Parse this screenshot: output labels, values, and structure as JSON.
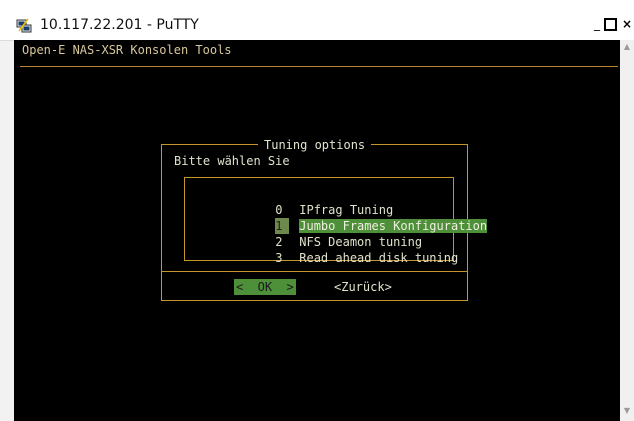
{
  "window": {
    "title": "10.117.22.201 - PuTTY",
    "icon": "putty-icon",
    "minimize_glyph": "_",
    "close_glyph": "×"
  },
  "terminal": {
    "header": "Open-E NAS-XSR Konsolen Tools",
    "colors": {
      "background": "#000000",
      "border": "#c5962c",
      "highlight": "#4e8f3a"
    }
  },
  "dialog": {
    "title": "Tuning options",
    "prompt": "Bitte wählen Sie",
    "items": [
      {
        "num": "0",
        "label": "IPfrag Tuning",
        "selected": false
      },
      {
        "num": "1",
        "label": "Jumbo Frames Konfiguration",
        "selected": true
      },
      {
        "num": "2",
        "label": "NFS Deamon tuning",
        "selected": false
      },
      {
        "num": "3",
        "label": "Read ahead disk tuning",
        "selected": false
      }
    ],
    "ok_label": "<  OK  >",
    "back_label": "<Zurück>"
  },
  "scrollbar": {
    "up_glyph": "▲",
    "down_glyph": "▼"
  }
}
